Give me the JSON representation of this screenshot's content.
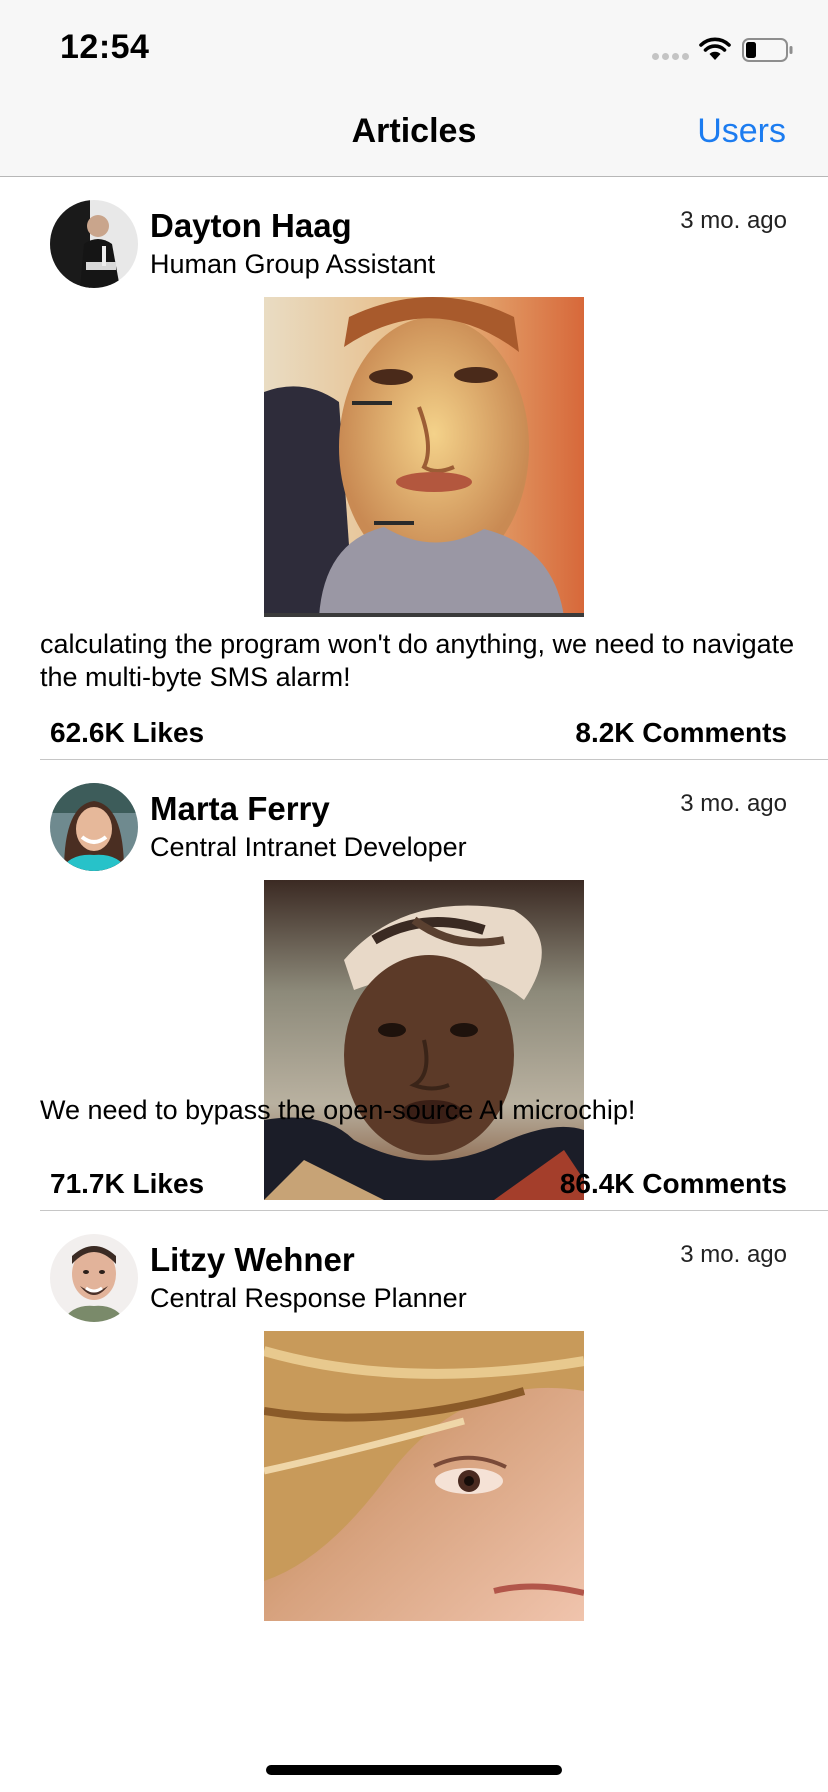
{
  "status_bar": {
    "time": "12:54",
    "icons": [
      "signal-dots-icon",
      "wifi-icon",
      "battery-icon"
    ]
  },
  "nav": {
    "title": "Articles",
    "right_button": "Users",
    "accent_color": "#1c7cf0"
  },
  "posts": [
    {
      "author": "Dayton Haag",
      "role": "Human Group Assistant",
      "time": "3 mo. ago",
      "body": "calculating the program won't do anything, we need to navigate the multi-byte SMS alarm!",
      "likes": "62.6K Likes",
      "comments": "8.2K Comments"
    },
    {
      "author": "Marta Ferry",
      "role": "Central Intranet Developer",
      "time": "3 mo. ago",
      "body": "We need to bypass the open-source AI microchip!",
      "likes": "71.7K Likes",
      "comments": "86.4K Comments"
    },
    {
      "author": "Litzy Wehner",
      "role": "Central Response Planner",
      "time": "3 mo. ago",
      "body": "",
      "likes": "",
      "comments": ""
    }
  ]
}
